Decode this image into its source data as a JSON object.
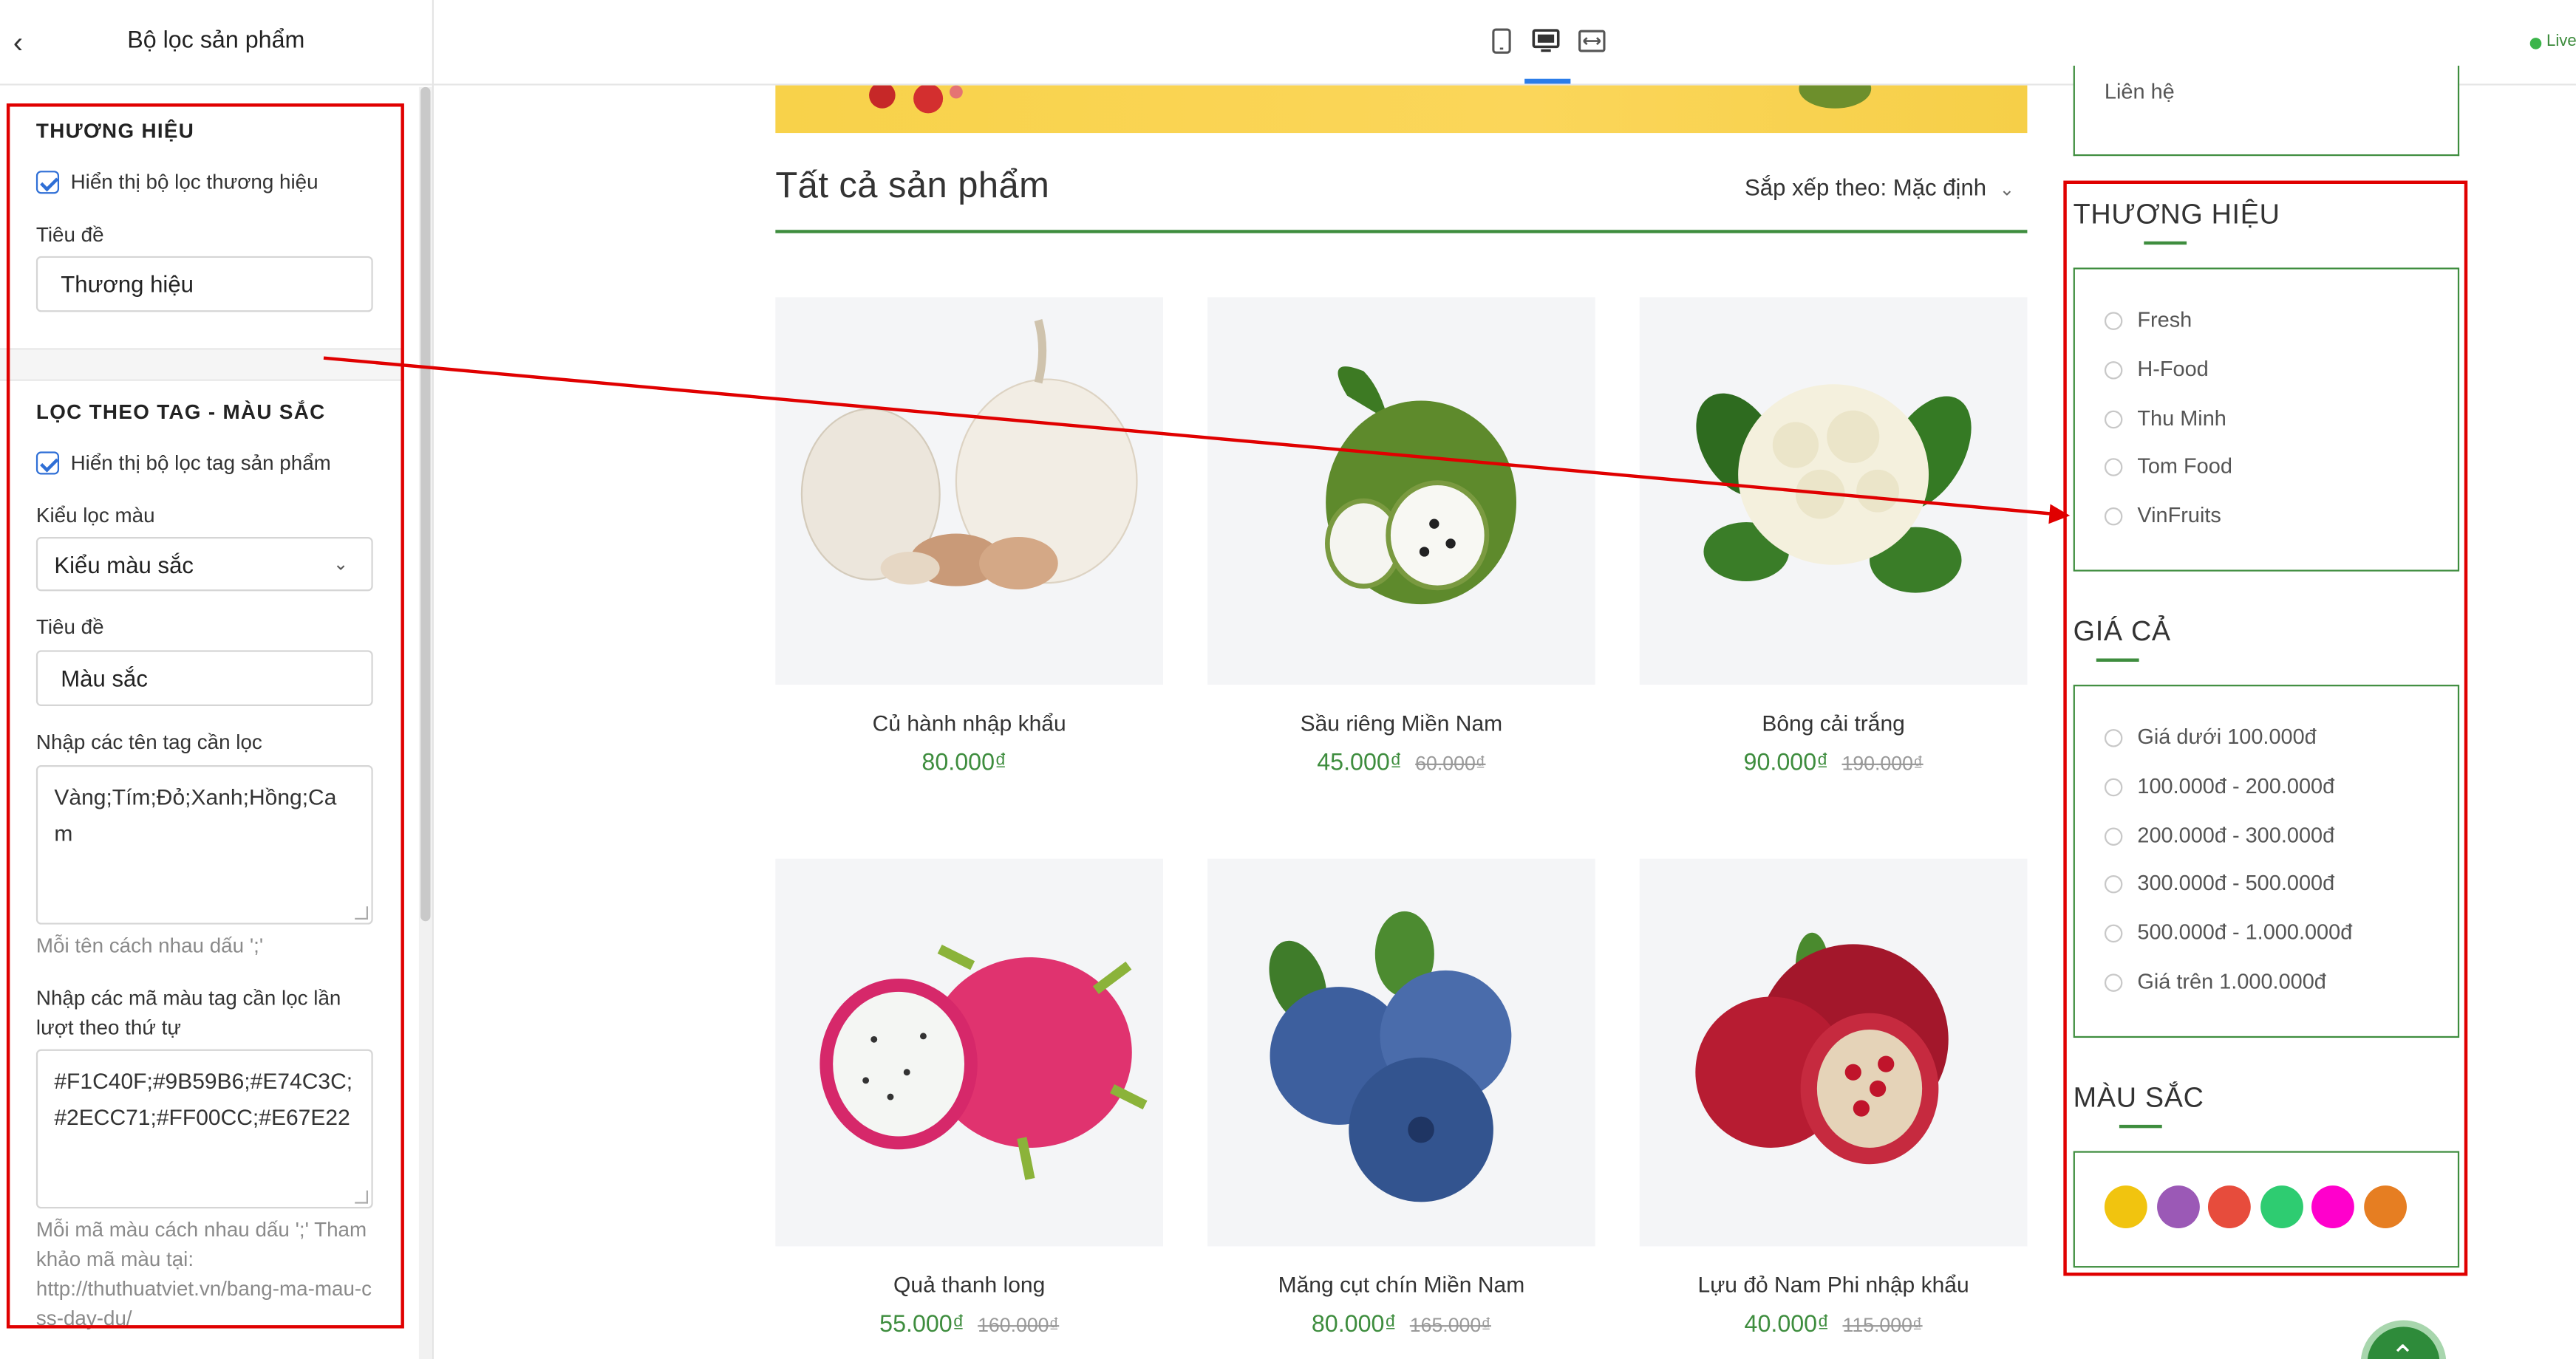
{
  "left_panel": {
    "title": "Bộ lọc sản phẩm",
    "back_icon": "chevron-left-icon",
    "brand": {
      "heading": "THƯƠNG HIỆU",
      "show_checkbox_label": "Hiển thị bộ lọc thương hiệu",
      "show_checked": true,
      "title_label": "Tiêu đề",
      "title_value": "Thương hiệu"
    },
    "tag": {
      "heading": "LỌC THEO TAG - MÀU SẮC",
      "show_checkbox_label": "Hiển thị bộ lọc tag sản phẩm",
      "show_checked": true,
      "filter_type_label": "Kiểu lọc màu",
      "filter_type_value": "Kiểu màu sắc",
      "title_label": "Tiêu đề",
      "title_value": "Màu sắc",
      "tag_names_label": "Nhập các tên tag cần lọc",
      "tag_names_value": "Vàng;Tím;Đỏ;Xanh;Hồng;Cam",
      "tag_names_hint": "Mỗi tên cách nhau dấu ';'",
      "color_codes_label": "Nhập các mã màu tag cần lọc lần lượt theo thứ tự",
      "color_codes_value": "#F1C40F;#9B59B6;#E74C3C;#2ECC71;#FF00CC;#E67E22",
      "color_codes_hint_1": "Mỗi mã màu cách nhau dấu ';' Tham khảo mã màu tại:",
      "color_codes_hint_2": "http://thuthuatviet.vn/bang-ma-mau-css-day-du/"
    }
  },
  "topbar": {
    "devices": [
      "mobile-icon",
      "desktop-icon",
      "fullwidth-icon"
    ],
    "active_device": "desktop-icon",
    "live_label": "Live"
  },
  "main": {
    "partial_text": "Liên hệ",
    "section_title": "Tất cả sản phẩm",
    "sort_label": "Sắp xếp theo:",
    "sort_value": "Mặc định",
    "products": [
      {
        "name": "Củ hành nhập khẩu",
        "price": "80.000₫",
        "old_price": ""
      },
      {
        "name": "Sầu riêng Miền Nam",
        "price": "45.000₫",
        "old_price": "60.000₫"
      },
      {
        "name": "Bông cải trắng",
        "price": "90.000₫",
        "old_price": "190.000₫"
      },
      {
        "name": "Quả thanh long",
        "price": "55.000₫",
        "old_price": "160.000₫"
      },
      {
        "name": "Măng cụt chín Miền Nam",
        "price": "80.000₫",
        "old_price": "165.000₫"
      },
      {
        "name": "Lựu đỏ Nam Phi nhập khẩu",
        "price": "40.000₫",
        "old_price": "115.000₫"
      }
    ]
  },
  "sidebar": {
    "brand_heading": "THƯƠNG HIỆU",
    "brands": [
      "Fresh",
      "H-Food",
      "Thu Minh",
      "Tom Food",
      "VinFruits"
    ],
    "price_heading": "GIÁ CẢ",
    "prices": [
      "Giá dưới 100.000đ",
      "100.000đ - 200.000đ",
      "200.000đ - 300.000đ",
      "300.000đ - 500.000đ",
      "500.000đ - 1.000.000đ",
      "Giá trên 1.000.000đ"
    ],
    "color_heading": "MÀU SẮC",
    "colors": [
      "#F1C40F",
      "#9B59B6",
      "#E74C3C",
      "#2ECC71",
      "#FF00CC",
      "#E67E22"
    ]
  }
}
